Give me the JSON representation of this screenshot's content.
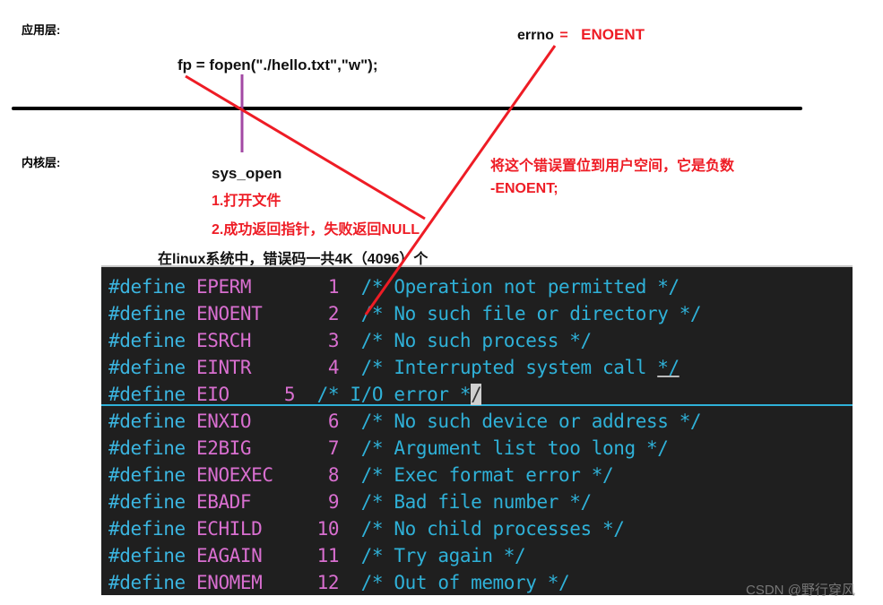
{
  "labels": {
    "app_layer": "应用层:",
    "kernel_layer": "内核层:",
    "fopen_call": "fp = fopen(\"./hello.txt\",\"w\");",
    "errno_word": "errno",
    "errno_eq": "=",
    "errno_value": "ENOENT",
    "sys_open": "sys_open",
    "step1": "1.打开文件",
    "step2": "2.成功返回指针，失败返回NULL",
    "set_error_note": "将这个错误置位到用户空间，它是负数",
    "neg_enoent": "-ENOENT;",
    "error_count_note": "在linux系统中，错误码一共4K（4096）个"
  },
  "colors": {
    "annotation_red": "#ee1c25",
    "syscall_purple": "#a349a4",
    "divider_black": "#000000",
    "code_bg": "#1f1f1f",
    "keyword": "#3bb5e0",
    "macro_name": "#d96fd0",
    "comment": "#2fb1d8"
  },
  "code": {
    "lines": [
      {
        "kw": "#define",
        "name": "EPERM",
        "num": "1",
        "comment": "/* Operation not permitted */"
      },
      {
        "kw": "#define",
        "name": "ENOENT",
        "num": "2",
        "comment": "/* No such file or directory */"
      },
      {
        "kw": "#define",
        "name": "ESRCH",
        "num": "3",
        "comment": "/* No such process */"
      },
      {
        "kw": "#define",
        "name": "EINTR",
        "num": "4",
        "comment": "/* Interrupted system call */"
      },
      {
        "kw": "#define",
        "name": "EIO",
        "num": "5",
        "comment": "/* I/O error */",
        "cursor": true
      },
      {
        "kw": "#define",
        "name": "ENXIO",
        "num": "6",
        "comment": "/* No such device or address */"
      },
      {
        "kw": "#define",
        "name": "E2BIG",
        "num": "7",
        "comment": "/* Argument list too long */"
      },
      {
        "kw": "#define",
        "name": "ENOEXEC",
        "num": "8",
        "comment": "/* Exec format error */"
      },
      {
        "kw": "#define",
        "name": "EBADF",
        "num": "9",
        "comment": "/* Bad file number */"
      },
      {
        "kw": "#define",
        "name": "ECHILD",
        "num": "10",
        "comment": "/* No child processes */"
      },
      {
        "kw": "#define",
        "name": "EAGAIN",
        "num": "11",
        "comment": "/* Try again */"
      },
      {
        "kw": "#define",
        "name": "ENOMEM",
        "num": "12",
        "comment": "/* Out of memory */"
      }
    ]
  },
  "watermark": "CSDN @野行穿风"
}
